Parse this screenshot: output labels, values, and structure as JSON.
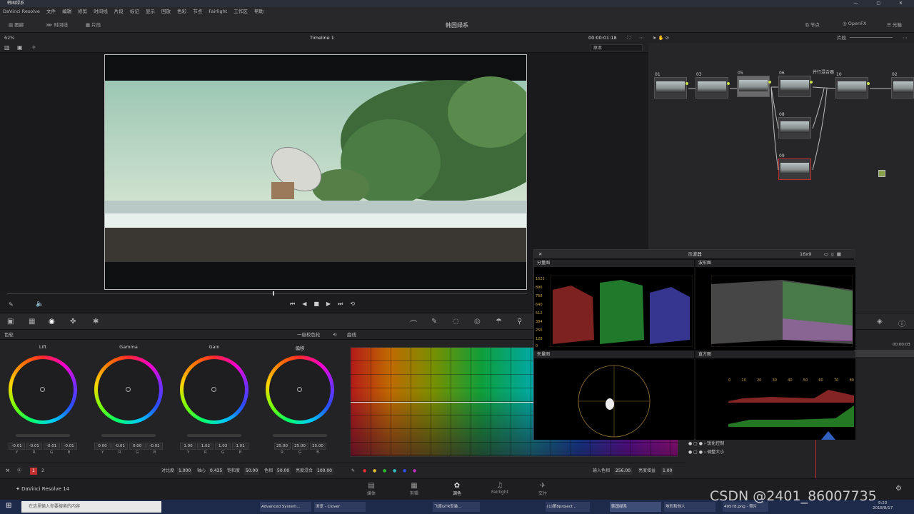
{
  "window": {
    "title": "韩国绿系",
    "app_name": "DaVinci Resolve"
  },
  "menu": [
    "DaVinci Resolve",
    "文件",
    "编辑",
    "修剪",
    "时间线",
    "片段",
    "标记",
    "显示",
    "回放",
    "色彩",
    "节点",
    "Fairlight",
    "工作区",
    "帮助"
  ],
  "toolbar": {
    "left": [
      "图廊",
      "时间线",
      "片段"
    ],
    "project_title": "韩国绿系",
    "right": [
      "节点",
      "OpenFX",
      "光箱"
    ]
  },
  "viewer": {
    "zoom": "62%",
    "timeline": "Timeline 1",
    "timecode": "00:00:01:18",
    "source": "原本"
  },
  "nodes": {
    "mode": "片段",
    "items": [
      {
        "num": "01",
        "tag": ""
      },
      {
        "num": "03",
        "tag": ""
      },
      {
        "num": "05",
        "tag": ""
      },
      {
        "num": "06",
        "tag": ""
      },
      {
        "num": "08",
        "tag": ""
      },
      {
        "num": "09",
        "tag": ""
      },
      {
        "num": "10",
        "tag": ""
      },
      {
        "num": "02",
        "tag": ""
      }
    ],
    "parallel_label": "并行混合器"
  },
  "wheels": {
    "header": "色轮",
    "mode": "一级校色轮",
    "blocks": [
      {
        "label": "Lift",
        "values": [
          "-0.01",
          "-0.01",
          "-0.01",
          "-0.01"
        ],
        "channels": [
          "Y",
          "R",
          "G",
          "B"
        ]
      },
      {
        "label": "Gamma",
        "values": [
          "0.00",
          "-0.01",
          "0.00",
          "-0.02"
        ],
        "channels": [
          "Y",
          "R",
          "G",
          "B"
        ]
      },
      {
        "label": "Gain",
        "values": [
          "1.00",
          "1.02",
          "1.03",
          "1.01"
        ],
        "channels": [
          "Y",
          "R",
          "G",
          "B"
        ]
      },
      {
        "label": "偏移",
        "values": [
          "25.00",
          "25.00",
          "25.00"
        ],
        "channels": [
          "R",
          "G",
          "B"
        ]
      }
    ],
    "footer": {
      "page_1": "1",
      "page_2": "2",
      "contrast_label": "对比度",
      "contrast": "1.000",
      "pivot_label": "轴心",
      "pivot": "0.435",
      "sat_label": "饱和度",
      "sat": "50.00",
      "hue_label": "色相",
      "hue": "50.00",
      "lummix_label": "亮度混合",
      "lummix": "100.00"
    }
  },
  "curves": {
    "header": "曲线",
    "footer": {
      "in_hue_label": "输入色相",
      "in_hue": "256.00",
      "lum_gain_label": "亮度增益",
      "lum_gain": "1.00"
    }
  },
  "scopes": {
    "title": "示波器",
    "layout": "16x9",
    "cells": [
      "分量图",
      "波形图",
      "矢量图",
      "直方图"
    ],
    "scale": [
      "1023",
      "896",
      "768",
      "640",
      "512",
      "384",
      "256",
      "128",
      "0"
    ],
    "hist_scale": [
      "0",
      "10",
      "20",
      "30",
      "40",
      "50",
      "60",
      "70",
      "80"
    ]
  },
  "right_panel": {
    "rows": [
      "锐化控制",
      "调整大小"
    ],
    "timecode": "00:00:03"
  },
  "bottom_nav": [
    {
      "label": "媒体",
      "icon": "media-icon"
    },
    {
      "label": "剪辑",
      "icon": "edit-icon"
    },
    {
      "label": "调色",
      "icon": "color-icon"
    },
    {
      "label": "Fairlight",
      "icon": "fairlight-icon"
    },
    {
      "label": "交付",
      "icon": "deliver-icon"
    }
  ],
  "brand": "DaVinci Resolve 14",
  "taskbar": {
    "search_placeholder": "在这里输入你要搜索的内容",
    "items": [
      "Advanced System...",
      "浏览 - Clover",
      "飞度GTR安装...",
      "[1]第8project ..",
      "韩国绿系",
      "地形和他人",
      "49578.png - 照片"
    ],
    "time": "9:23",
    "date": "2018/8/17"
  },
  "watermark": "CSDN @2401_86007735"
}
